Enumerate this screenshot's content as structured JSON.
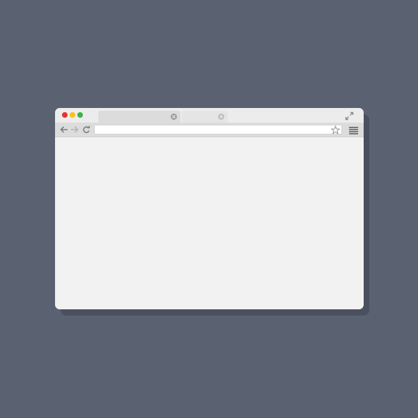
{
  "window": {
    "traffic_lights": [
      {
        "name": "close",
        "color": "#e8312f"
      },
      {
        "name": "minimize",
        "color": "#f6c21a"
      },
      {
        "name": "maximize",
        "color": "#3fb14a"
      }
    ],
    "tabs": [
      {
        "label": "",
        "active": true
      },
      {
        "label": "",
        "active": false
      }
    ],
    "toolbar": {
      "url_value": "",
      "icons": [
        "back-arrow-icon",
        "forward-arrow-icon",
        "reload-icon",
        "bookmark-star-icon",
        "hamburger-menu-icon"
      ]
    },
    "titlebar_icons": [
      "expand-icon"
    ]
  },
  "colors": {
    "background": "#5a6171",
    "window": "#f2f2f2",
    "titlebar": "#ececec",
    "toolbar": "#dcdcdc"
  }
}
